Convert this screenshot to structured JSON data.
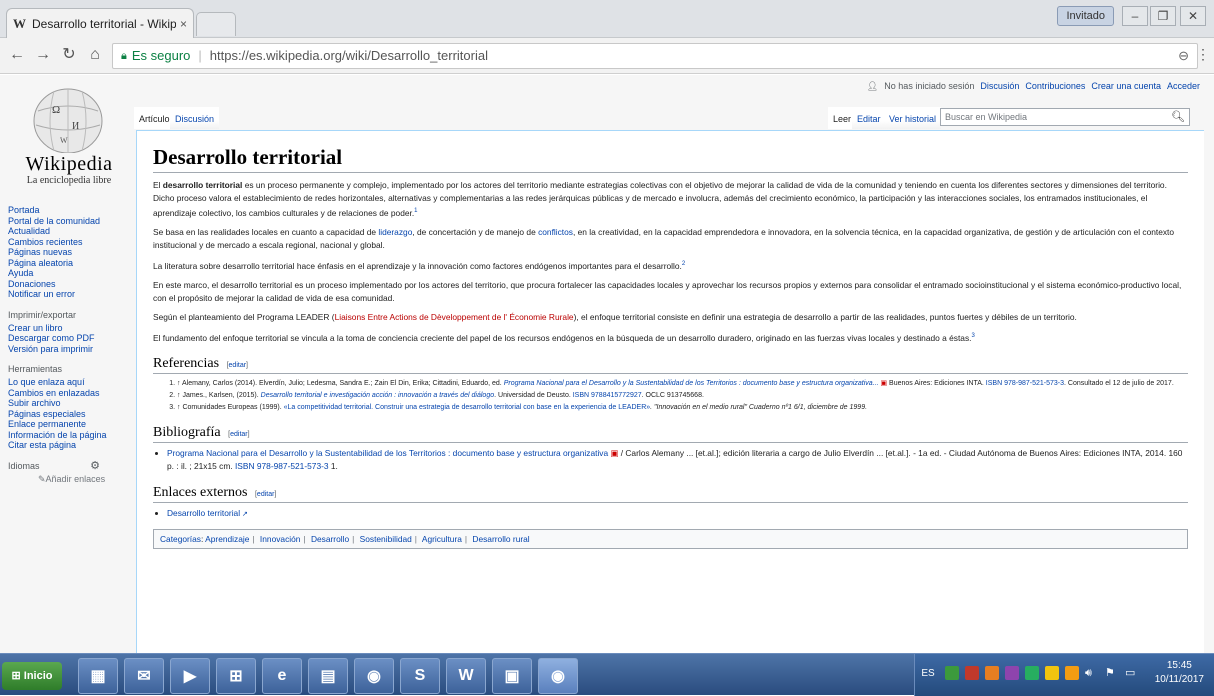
{
  "browser": {
    "tab_title": "Desarrollo territorial - Wikip",
    "tab_favicon": "W",
    "tab_close": "×",
    "guest_label": "Invitado",
    "window_buttons": [
      "–",
      "❐",
      "✕"
    ],
    "security_label": "Es seguro",
    "url": "https://es.wikipedia.org/wiki/Desarrollo_territorial"
  },
  "wiki": {
    "wordmark": "Wikipedia",
    "tagline": "La enciclopedia libre",
    "personal": {
      "not_logged": "No has iniciado sesión",
      "discussion": "Discusión",
      "contributions": "Contribuciones",
      "create_account": "Crear una cuenta",
      "login": "Acceder"
    },
    "tabs": {
      "article": "Artículo",
      "discussion": "Discusión",
      "read": "Leer",
      "edit": "Editar",
      "history": "Ver historial"
    },
    "search_placeholder": "Buscar en Wikipedia",
    "sidebar": {
      "main": [
        "Portada",
        "Portal de la comunidad",
        "Actualidad",
        "Cambios recientes",
        "Páginas nuevas",
        "Página aleatoria",
        "Ayuda",
        "Donaciones",
        "Notificar un error"
      ],
      "print_head": "Imprimir/exportar",
      "print": [
        "Crear un libro",
        "Descargar como PDF",
        "Versión para imprimir"
      ],
      "tools_head": "Herramientas",
      "tools": [
        "Lo que enlaza aquí",
        "Cambios en enlazadas",
        "Subir archivo",
        "Páginas especiales",
        "Enlace permanente",
        "Información de la página",
        "Citar esta página"
      ],
      "languages_head": "Idiomas",
      "add_languages": "Añadir enlaces"
    },
    "article": {
      "title": "Desarrollo territorial",
      "p1_pre": "El ",
      "p1_bold": "desarrollo territorial",
      "p1_post": " es un proceso permanente y complejo, implementado por los actores del territorio mediante estrategias colectivas con el objetivo de mejorar la calidad de vida de la comunidad y teniendo en cuenta los diferentes sectores y dimensiones del territorio. Dicho proceso valora el establecimiento de redes horizontales, alternativas y complementarias a las redes jerárquicas públicas y de mercado e involucra, además del crecimiento económico, la participación y las interacciones sociales, los entramados institucionales, el aprendizaje colectivo, los cambios culturales y de relaciones de poder.",
      "p1_sup": "1",
      "p2_a": "Se basa en las realidades locales en cuanto a capacidad de ",
      "p2_link1": "liderazgo",
      "p2_b": ", de concertación y de manejo de ",
      "p2_link2": "conflictos",
      "p2_c": ", en la creatividad, en la capacidad emprendedora e innovadora, en la solvencia técnica, en la capacidad organizativa, de gestión y de articulación con el contexto institucional y de mercado a escala regional, nacional y global.",
      "p3": "La literatura sobre desarrollo territorial hace énfasis en el aprendizaje y la innovación como factores endógenos importantes para el desarrollo.",
      "p3_sup": "2",
      "p4": "En este marco, el desarrollo territorial es un proceso implementado por los actores del territorio, que procura fortalecer las capacidades locales y aprovechar los recursos propios y externos para consolidar el entramado socioinstitucional y el sistema económico-productivo local, con el propósito de mejorar la calidad de vida de esa comunidad.",
      "p5_a": "Según el planteamiento del Programa LEADER (",
      "p5_red": "Liaisons Entre Actions de Dèveloppement de l' Économie Rurale",
      "p5_b": "), el enfoque territorial consiste en definir una estrategia de desarrollo a partir de las realidades, puntos fuertes y débiles de un territorio.",
      "p6": "El fundamento del enfoque territorial se vincula a la toma de conciencia creciente del papel de los recursos endógenos en la búsqueda de un desarrollo duradero, originado en las fuerzas vivas locales y destinado a éstas.",
      "p6_sup": "3"
    },
    "edit_label": "editar",
    "references": {
      "heading": "Referencias",
      "items": [
        {
          "pre": "↑ Alemany, Carlos (2014). Elverdín, Julio; Ledesma, Sandra E.; Zain El Din, Erika; Cittadini, Eduardo, ed. ",
          "link": "Programa Nacional para el Desarrollo y la Sustentabilidad de los Territorios : documento base y estructura organizativa...",
          "post": " Buenos Aires: Ediciones INTA. ",
          "isbn": "ISBN 978-987-521-573-3",
          "tail": ". Consultado el 12 de julio de 2017."
        },
        {
          "pre": "↑ James., Karlsen, (2015). ",
          "link": "Desarrollo territorial e investigación acción : innovación a través del diálogo",
          "post": ". Universidad de Deusto. ",
          "isbn": "ISBN 9788415772927",
          "tail": ". OCLC 913745668."
        },
        {
          "pre": "↑ Comunidades Europeas (1999). ",
          "link": "«La competitividad territorial. Construir una estrategia de desarrollo territorial con base en la experiencia de LEADER»",
          "post": ". \"Innovación en el medio rural\" Cuaderno nº1 6/1, diciembre de 1999.",
          "isbn": "",
          "tail": ""
        }
      ]
    },
    "bibliography": {
      "heading": "Bibliografía",
      "link": "Programa Nacional para el Desarrollo y la Sustentabilidad de los Territorios : documento base y estructura organizativa",
      "text": " / Carlos Alemany ... [et.al.]; edición literaria a cargo de Julio Elverdín ... [et.al.]. - 1a ed. - Ciudad Autónoma de Buenos Aires: Ediciones INTA, 2014. 160 p. : il. ; 21x15 cm. ",
      "isbn": "ISBN 978-987-521-573-3",
      "tail": " 1."
    },
    "external": {
      "heading": "Enlaces externos",
      "link": "Desarrollo territorial"
    },
    "categories": {
      "label": "Categorías",
      "items": [
        "Aprendizaje",
        "Innovación",
        "Desarrollo",
        "Sostenibilidad",
        "Agricultura",
        "Desarrollo rural"
      ]
    }
  },
  "taskbar": {
    "start_label": "Inicio",
    "language": "ES",
    "time": "15:45",
    "date": "10/11/2017"
  },
  "colors": {
    "link": "#0645ad",
    "redlink": "#ba0000",
    "secure": "#0b8043",
    "taskbar": "#2a4c7f"
  }
}
